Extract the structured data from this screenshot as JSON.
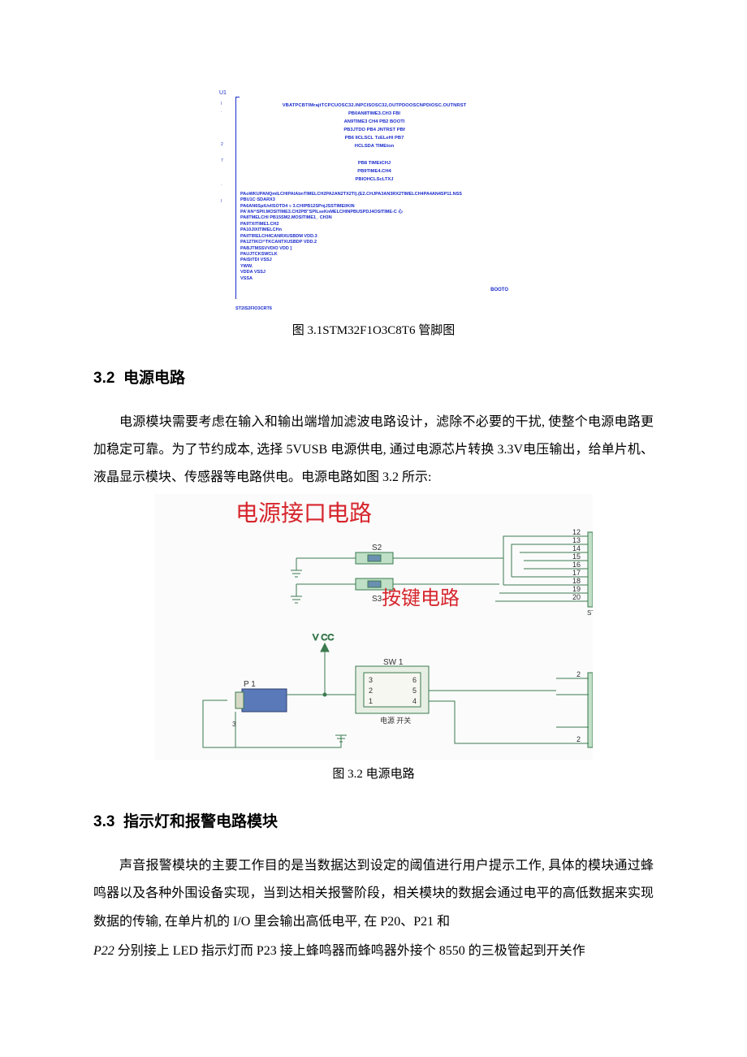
{
  "pin_diagram": {
    "ref": "U1",
    "top_long": "VBATPCBTIMrajtTCPCUOSC32.INPCISOSC32,OUTPDOOSCNPDIOSC.OUTNRST",
    "center_group": [
      "PB0AN8TIME3.CH3 FBl",
      "AN9TIME3 CH4 PB2 BOOTl",
      "PB3JTDO PB4 JNTRST PBf",
      "PB6 IICLSCL TzELeHl PB7",
      "HCLSDA TIMEton"
    ],
    "center_group2": [
      "PB8 TIMEtCHJ",
      "PB9TIME4.CH4",
      "PBIOHCLScLTXJ"
    ],
    "left_group": [
      "PAoWKUPANQmlLCHlPAlAbnTIMELCH2PA2AN2TX2Tl).(E2.CHJPA3AN3RX2TIMELCH4PA4AN4SP11.NSS",
      "PBU1C·SDARX3",
      "PA6AN6SpiUvllSOTD4 ≡ 3.CHlPB12SPnjJSSTIMEI/KIN",
      "PA'AN^SPll.MOSITIME3.CH2PB\"SPILseKnMELCHINPBUSPDJ4OSITIME-C 心",
      "PA8TMELCHl               PB15SM2.MOSITIME1_ CH3N",
      "PA9TXITIME1.CH2",
      "PA10JIXlTIMELCHn",
      "PAllTlRELCH4CANRXUSBDM                 VDD.3",
      "PA12TlKCl^TKCANTXUSBDP                VDD.2",
      "PABJTMSSVVDIO          VDD ]",
      "PAUJTCKSWCLK",
      "PAIStTDl                    VSSJ",
      "   YWW.",
      "  VDDA  VSSJ",
      "  VSSA"
    ],
    "booto": "BOOTO",
    "footer": "ST2IS2FlO3CRT6",
    "side_nums": [
      "l",
      "·",
      "",
      "",
      "",
      "2",
      "",
      "7",
      "",
      "",
      "·",
      "",
      "l"
    ]
  },
  "fig1_caption_prefix": "图 3.1",
  "fig1_caption_code": "STM32F1O3C8T6",
  "fig1_caption_suffix": " 管脚图",
  "section32_num": "3.2",
  "section32_title": "电源电路",
  "para32": "电源模块需要考虑在输入和输出端增加滤波电路设计，滤除不必要的干扰, 使整个电源电路更加稳定可靠。为了节约成本, 选择 5VUSB 电源供电, 通过电源芯片转换 3.3V电压输出，给单片机、液晶显示模块、传感器等电路供电。电源电路如图 3.2 所示:",
  "circuit": {
    "title": "电源接口电路",
    "button_label": "按键电路",
    "labels": {
      "s2": "S2",
      "s3": "S3",
      "vcc": "V CC",
      "sw1": "SW 1",
      "p1": "P 1",
      "st": "ST",
      "power_switch_cn": "电源 开关",
      "nums_sw_left": [
        "3",
        "2",
        "1"
      ],
      "nums_sw_right": [
        "6",
        "5",
        "4"
      ],
      "right_pins_top": [
        "12",
        "13",
        "14",
        "15",
        "16",
        "17",
        "18",
        "19",
        "20"
      ],
      "right_pins_bottom": [
        "2",
        "",
        "",
        "2"
      ],
      "p1_nums": [
        "",
        "",
        "3"
      ]
    }
  },
  "fig2_caption": "图 3.2 电源电路",
  "section33_num": "3.3",
  "section33_title": "指示灯和报警电路模块",
  "para33_a": "声音报警模块的主要工作目的是当数据达到设定的阈值进行用户提示工作, 具体的模块通过蜂鸣器以及各种外围设备实现，当到达相关报警阶段，相关模块的数据会通过电平的高低数据来实现数据的传输, 在单片机的 I/O 里会输出高低电平, 在 P20、P21 和",
  "para33_b_prefix_italic": "P22",
  "para33_b_rest": " 分别接上 LED 指示灯而 P23 接上蜂鸣器而蜂鸣器外接个 8550 的三极管起到开关作"
}
